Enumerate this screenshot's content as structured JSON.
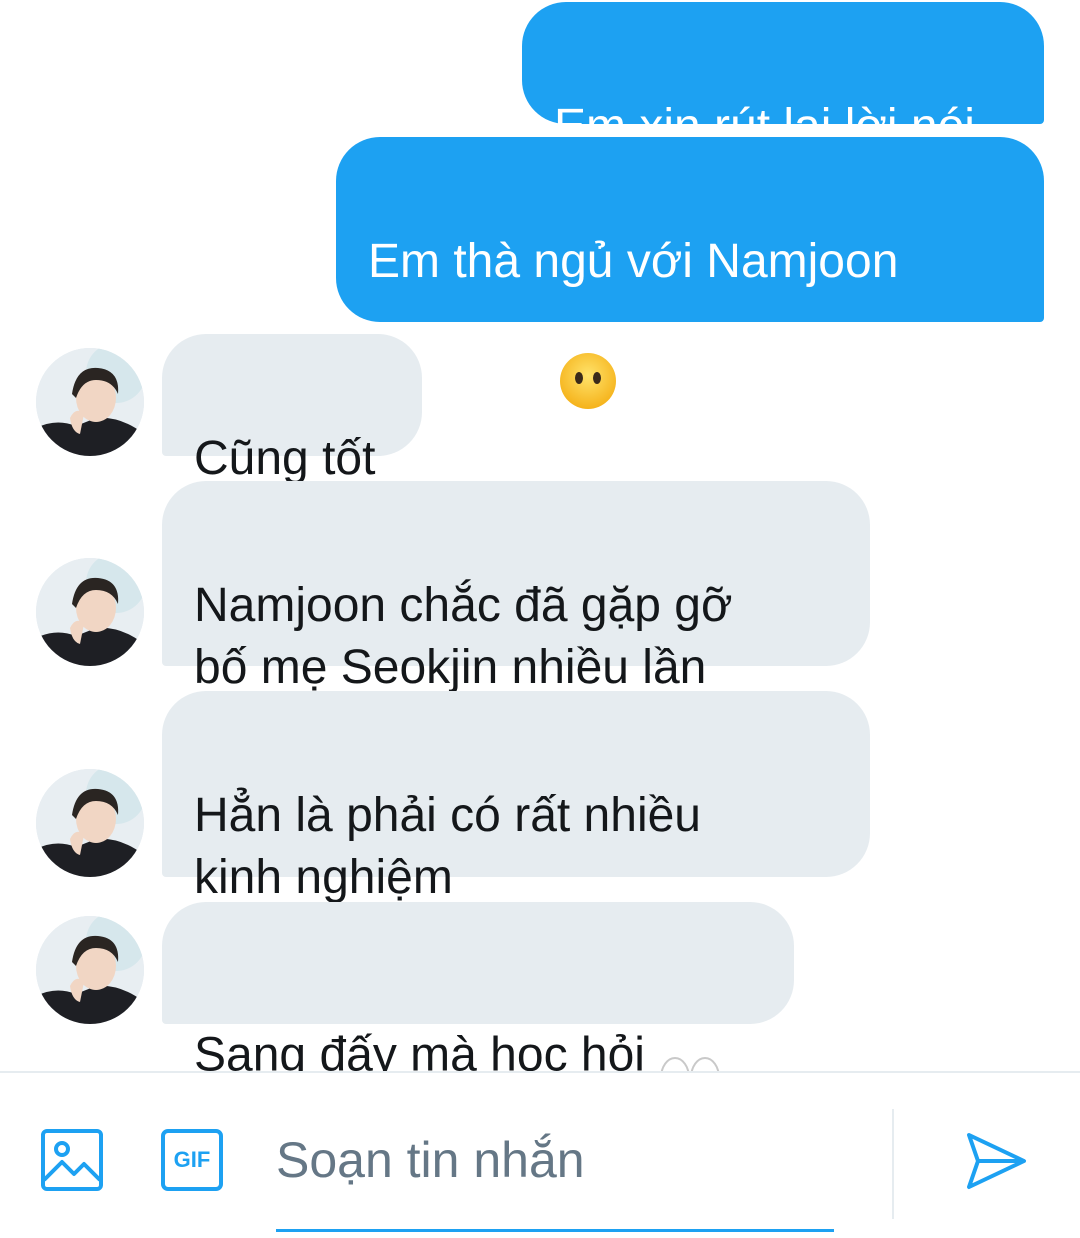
{
  "messages": [
    {
      "direction": "outgoing",
      "text": "Em xin rút lại lời nói"
    },
    {
      "direction": "outgoing",
      "text": "Em thà ngủ với Namjoon\ncòn hơn",
      "emoji": "face-without-mouth"
    },
    {
      "direction": "incoming",
      "text": "Cũng tốt"
    },
    {
      "direction": "incoming",
      "text": "Namjoon chắc đã gặp gỡ\nbố mẹ Seokjin nhiều lần"
    },
    {
      "direction": "incoming",
      "text": "Hẳn là phải có rất nhiều\nkinh nghiệm"
    },
    {
      "direction": "incoming",
      "text": "Sang đấy mà học hỏi",
      "emoji": "eyes"
    }
  ],
  "composer": {
    "placeholder": "Soạn tin nhắn",
    "value": "",
    "gif_label": "GIF",
    "icons": [
      "image-icon",
      "gif-icon",
      "send-icon"
    ]
  },
  "colors": {
    "accent": "#1da1f2",
    "incoming_bubble": "#e6ecf0",
    "placeholder": "#657786"
  }
}
